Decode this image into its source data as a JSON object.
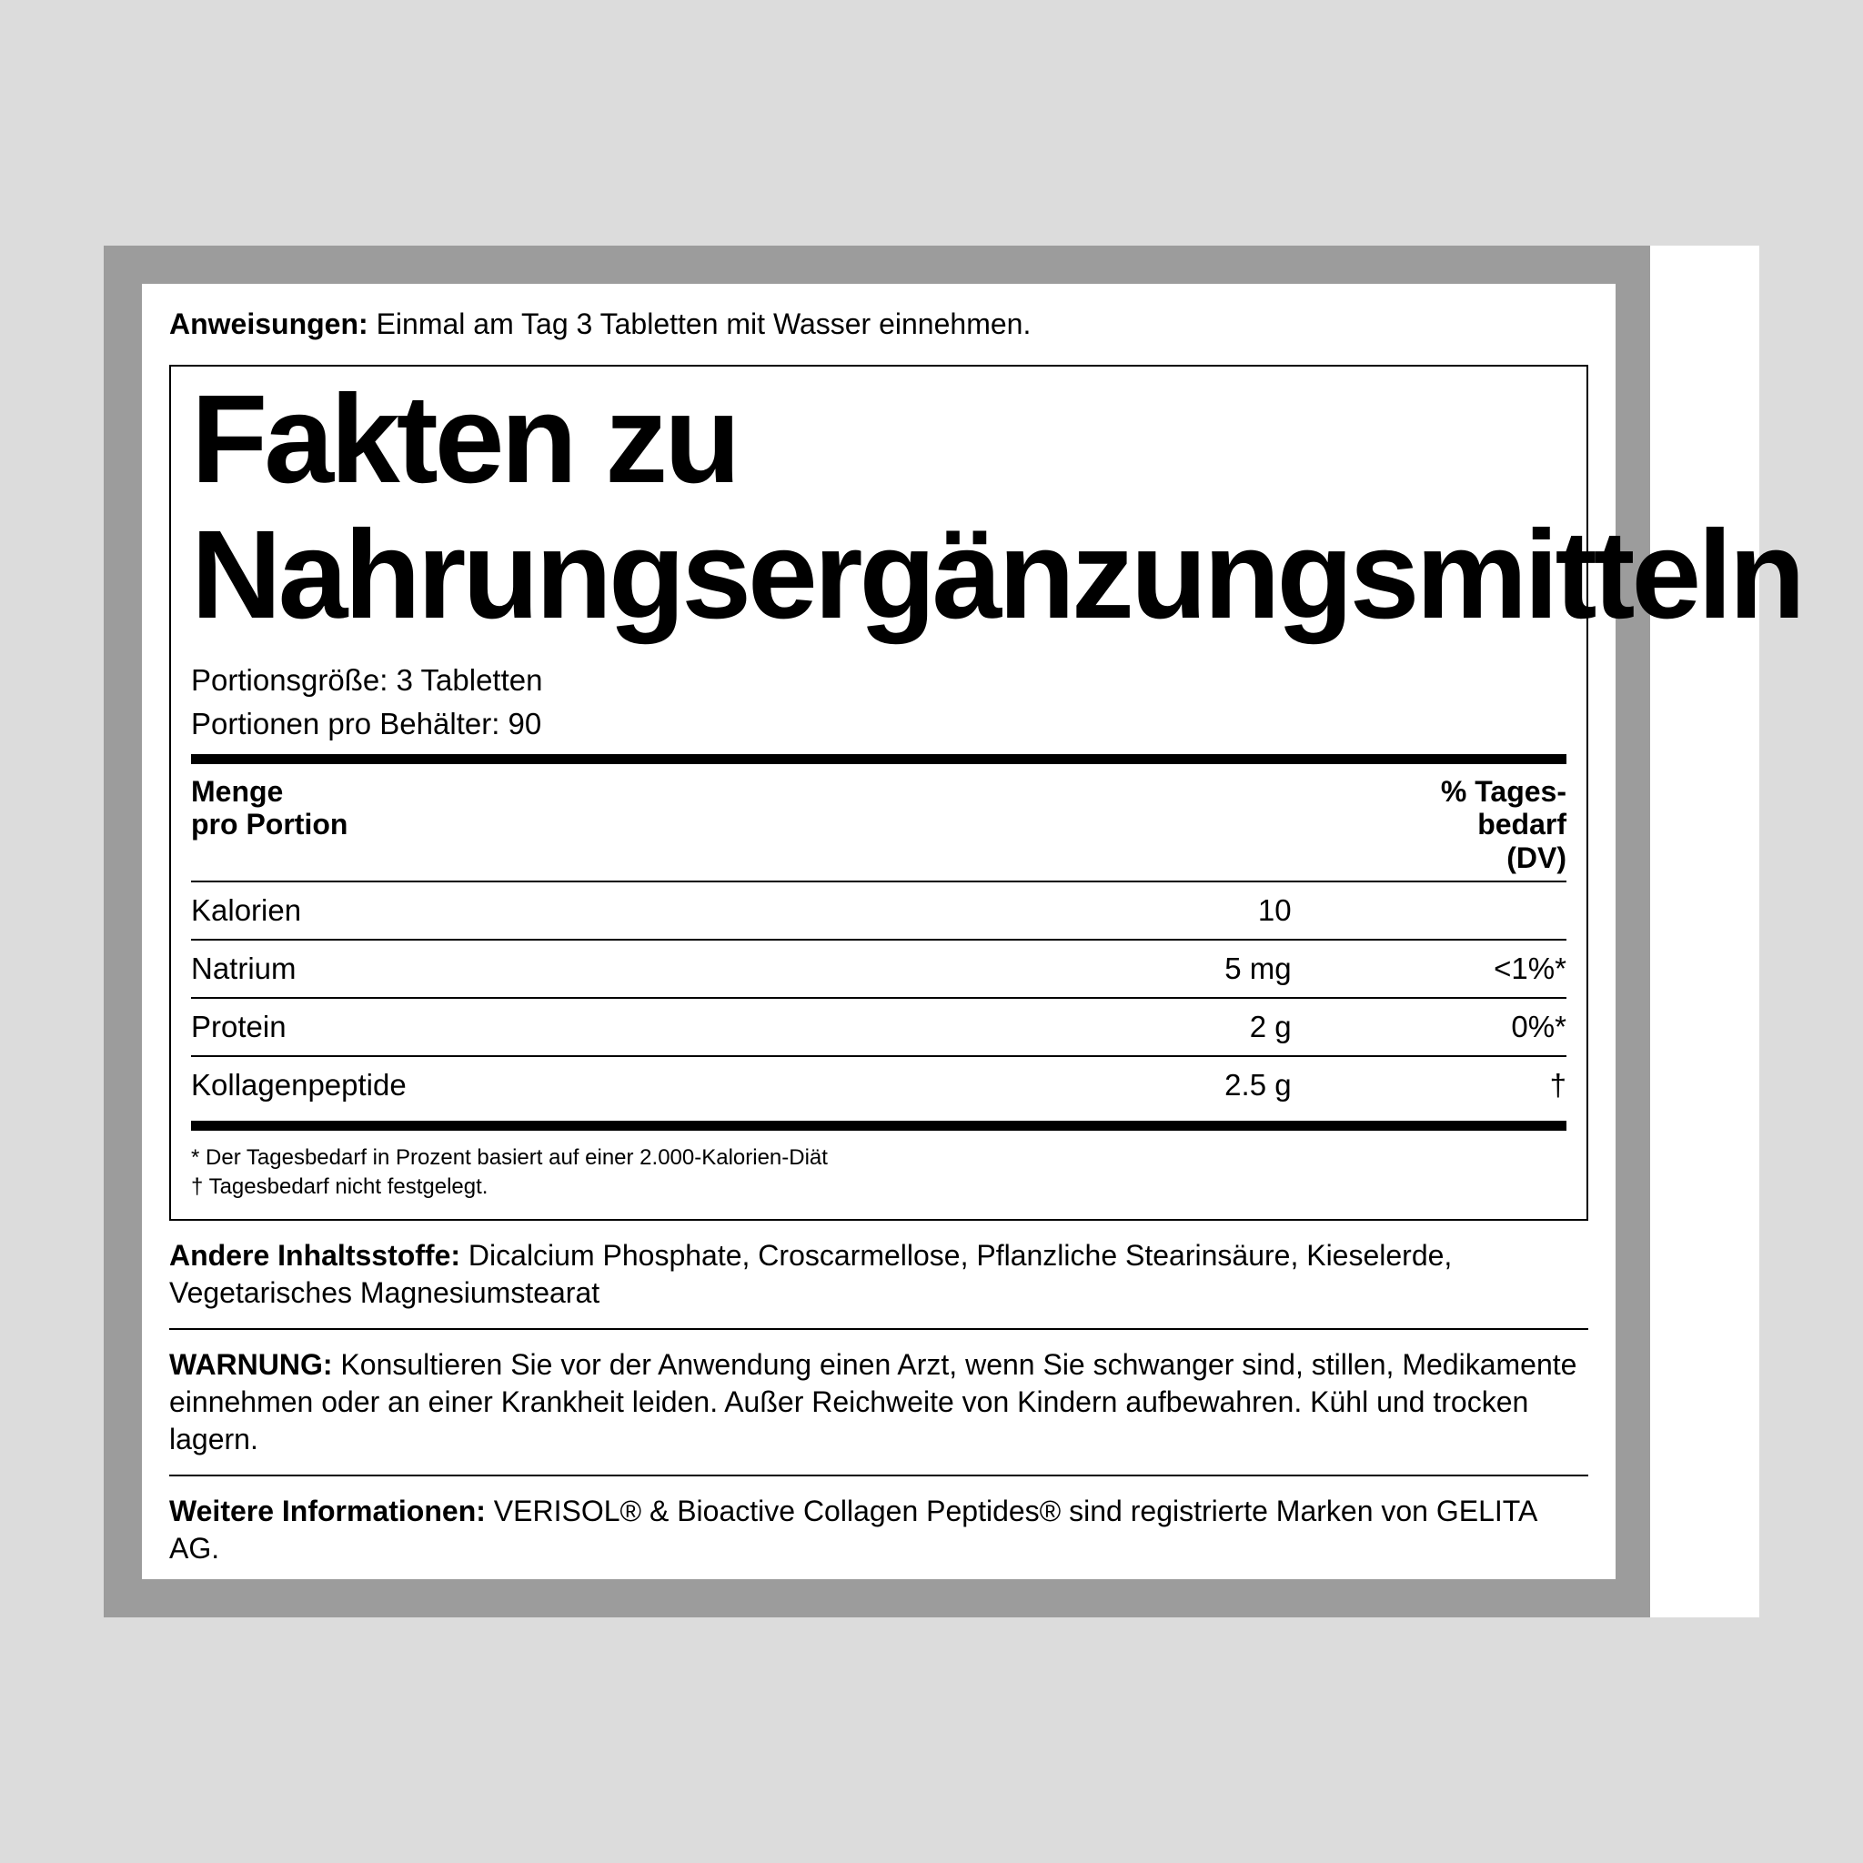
{
  "directions": {
    "label": "Anweisungen:",
    "text": " Einmal am Tag 3 Tabletten mit Wasser einnehmen."
  },
  "title": {
    "line1": "Fakten zu",
    "line2": "Nahrungsergänzungsmitteln"
  },
  "serving_size": "Portionsgröße: 3 Tabletten",
  "servings_per": "Portionen pro Behälter: 90",
  "header": {
    "left1": "Menge",
    "left2": "pro Portion",
    "right1": "% Tages-",
    "right2": "bedarf",
    "right3": "(DV)"
  },
  "rows": [
    {
      "name": "Kalorien",
      "amt": "10",
      "dv": ""
    },
    {
      "name": "Natrium",
      "amt": "5 mg",
      "dv": "<1%*"
    },
    {
      "name": "Protein",
      "amt": "2 g",
      "dv": "0%*"
    },
    {
      "name": "Kollagenpeptide",
      "amt": "2.5 g",
      "dv": "†"
    }
  ],
  "footnote1": "* Der Tagesbedarf in Prozent basiert auf einer 2.000-Kalorien-Diät",
  "footnote2": "† Tagesbedarf nicht festgelegt.",
  "other": {
    "label": "Andere Inhaltsstoffe:",
    "text": " Dicalcium Phosphate, Croscarmellose, Pflanzliche Stearinsäure, Kieselerde, Vegetarisches Magnesiumstearat"
  },
  "warning": {
    "label": "WARNUNG:",
    "text": " Konsultieren Sie vor der Anwendung einen Arzt, wenn Sie schwanger sind, stillen, Medikamente einnehmen oder an einer Krankheit leiden. Außer Reichweite von Kindern aufbewahren. Kühl und trocken lagern."
  },
  "moreinfo": {
    "label": "Weitere Informationen:",
    "text": " VERISOL® & Bioactive Collagen Peptides® sind registrierte Marken von GELITA AG."
  }
}
